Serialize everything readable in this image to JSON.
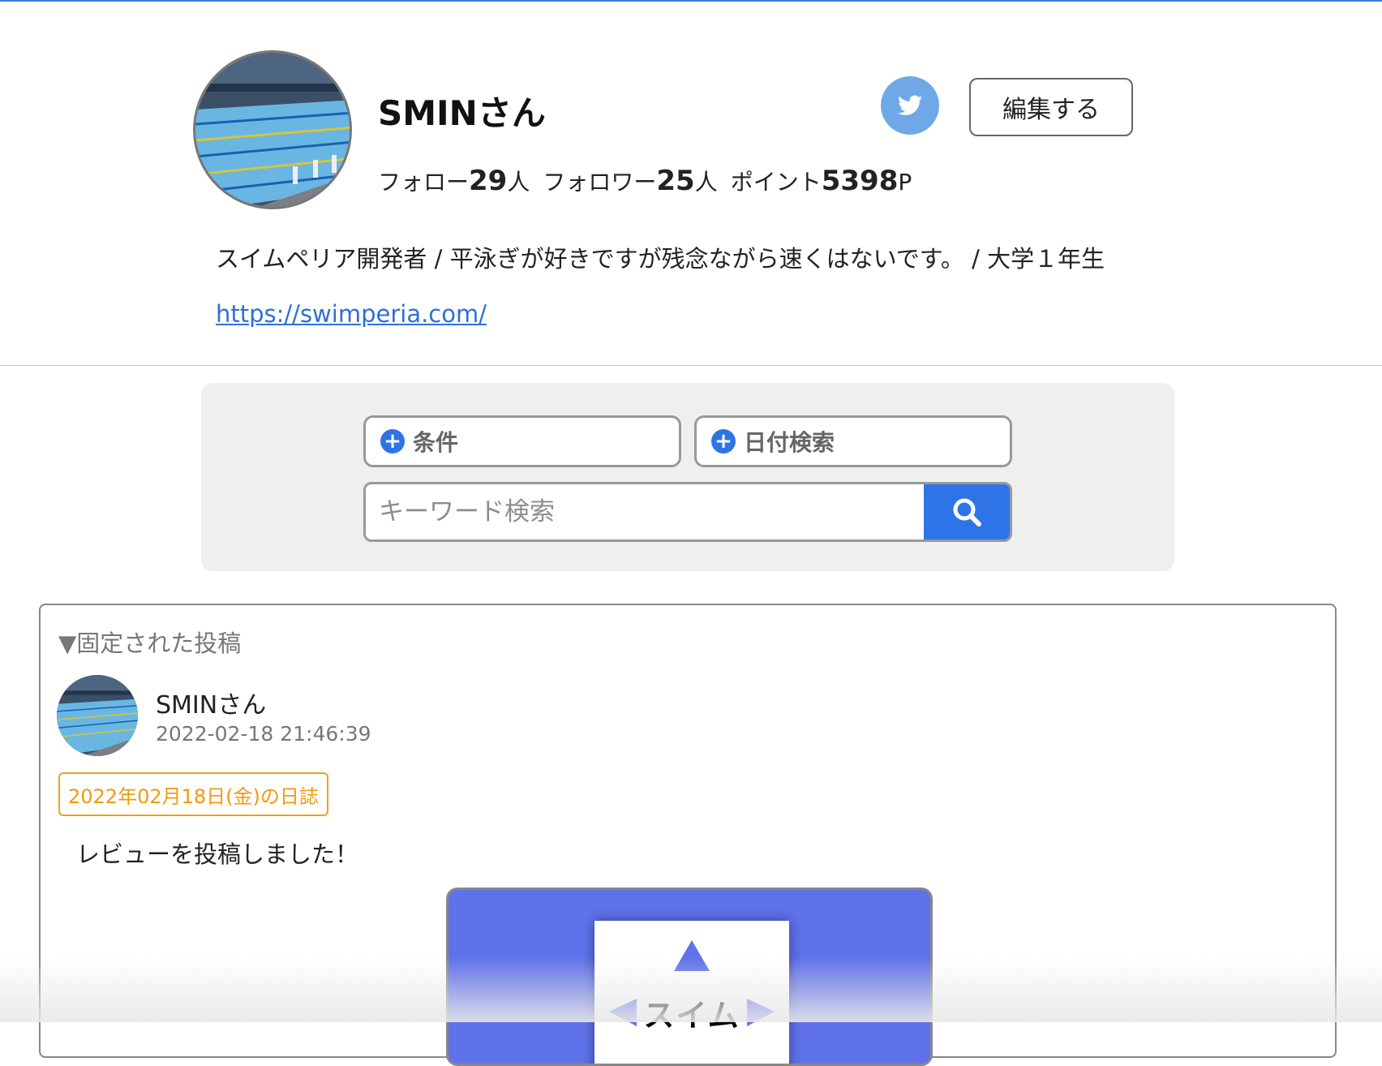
{
  "profile": {
    "name": "SMINさん",
    "follow_label": "フォロー",
    "follow_count": "29",
    "follow_unit": "人",
    "follower_label": "フォロワー",
    "follower_count": "25",
    "follower_unit": "人",
    "point_label": "ポイント",
    "point_value": "5398",
    "point_unit": "P",
    "bio": "スイムペリア開発者 / 平泳ぎが好きですが残念ながら速くはないです。 / 大学１年生",
    "link": "https://swimperia.com/",
    "edit_label": "編集する"
  },
  "search": {
    "condition_label": "条件",
    "date_label": "日付検索",
    "keyword_placeholder": "キーワード検索"
  },
  "pinned": {
    "title": "▼固定された投稿",
    "post": {
      "user": "SMINさん",
      "timestamp": "2022-02-18 21:46:39",
      "diary_tag": "2022年02月18日(金)の日誌",
      "text": "レビューを投稿しました！",
      "review_logo_text": "スイム"
    }
  },
  "icons": {
    "twitter": "twitter-bird-icon",
    "search": "magnifier-icon",
    "plus": "plus-circle-icon"
  },
  "colors": {
    "accent_blue": "#2f74e6",
    "twitter_blue": "#6ea8e6",
    "tag_orange": "#ef9a10",
    "review_card": "#6072ea"
  }
}
